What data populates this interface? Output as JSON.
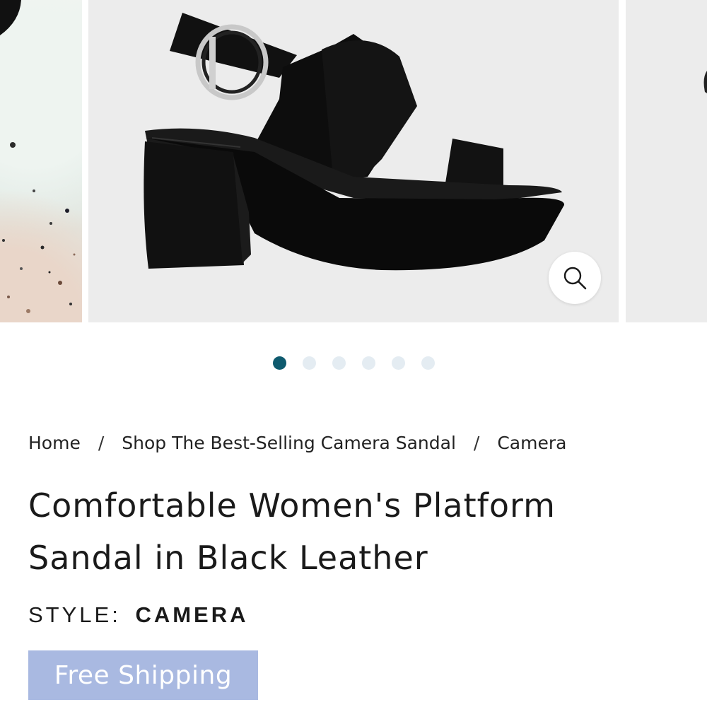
{
  "carousel": {
    "current_image_alt": "Black leather platform sandal with buckle ankle strap",
    "zoom_icon": "search-icon",
    "dots_total": 6,
    "active_dot_index": 0,
    "active_dot_color": "#0e5a6e",
    "inactive_dot_color": "#e4ecf2"
  },
  "breadcrumb": {
    "items": [
      "Home",
      "Shop The Best-Selling Camera Sandal",
      "Camera"
    ],
    "separator": "/"
  },
  "product": {
    "title": "Comfortable Women's Platform Sandal in Black Leather",
    "style_label": "STYLE:",
    "style_value": "CAMERA"
  },
  "badge": {
    "label": "Free Shipping",
    "color": "#a9b9e1"
  }
}
